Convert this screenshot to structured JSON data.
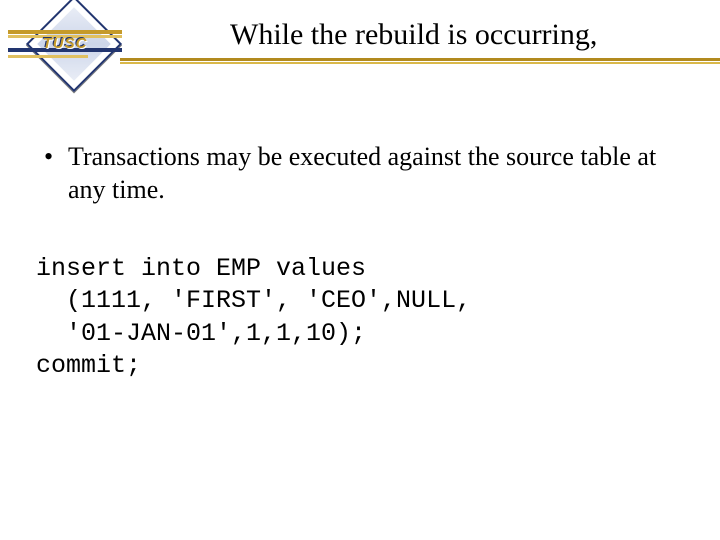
{
  "logo": {
    "text": "TUSC"
  },
  "header": {
    "title": "While the rebuild is occurring,"
  },
  "body": {
    "bullets": [
      "Transactions may be executed against the source table at any time."
    ],
    "code": "insert into EMP values\n  (1111, 'FIRST', 'CEO',NULL,\n  '01-JAN-01',1,1,10);\ncommit;"
  }
}
